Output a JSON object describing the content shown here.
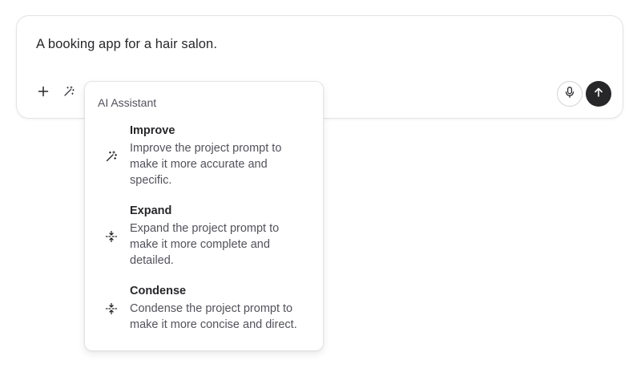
{
  "composer": {
    "prompt": "A booking app for a hair salon."
  },
  "toolbar": {
    "add_icon": "plus-icon",
    "ai_icon": "magic-wand-icon",
    "mic_icon": "microphone-icon",
    "send_icon": "arrow-up-icon"
  },
  "ai_menu": {
    "heading": "AI Assistant",
    "items": [
      {
        "icon": "magic-wand-icon",
        "title": "Improve",
        "description": "Improve the project prompt to make it more accurate and specific."
      },
      {
        "icon": "expand-icon",
        "title": "Expand",
        "description": "Expand the project prompt to make it more complete and detailed."
      },
      {
        "icon": "condense-icon",
        "title": "Condense",
        "description": "Condense the project prompt to make it more concise and direct."
      }
    ]
  },
  "colors": {
    "send_button": "#27272a",
    "border": "#e4e4e7",
    "muted_text": "#52525b"
  }
}
